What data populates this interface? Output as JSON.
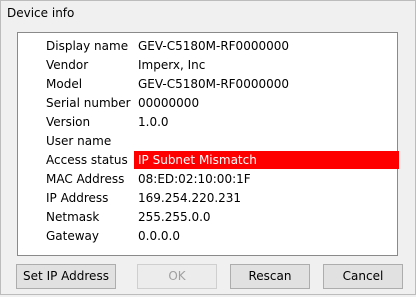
{
  "window": {
    "title": "Device info"
  },
  "fields": [
    {
      "label": "Display name",
      "value": "GEV-C5180M-RF0000000"
    },
    {
      "label": "Vendor",
      "value": "Imperx, Inc"
    },
    {
      "label": "Model",
      "value": "GEV-C5180M-RF0000000"
    },
    {
      "label": "Serial number",
      "value": "00000000"
    },
    {
      "label": "Version",
      "value": "1.0.0"
    },
    {
      "label": "User name",
      "value": ""
    },
    {
      "label": "Access status",
      "value": "IP Subnet Mismatch",
      "status_color": "#ff0000"
    },
    {
      "label": "MAC Address",
      "value": "08:ED:02:10:00:1F"
    },
    {
      "label": "IP Address",
      "value": "169.254.220.231"
    },
    {
      "label": "Netmask",
      "value": "255.255.0.0"
    },
    {
      "label": "Gateway",
      "value": "0.0.0.0"
    }
  ],
  "buttons": {
    "set_ip": "Set IP Address",
    "ok": "OK",
    "rescan": "Rescan",
    "cancel": "Cancel"
  }
}
